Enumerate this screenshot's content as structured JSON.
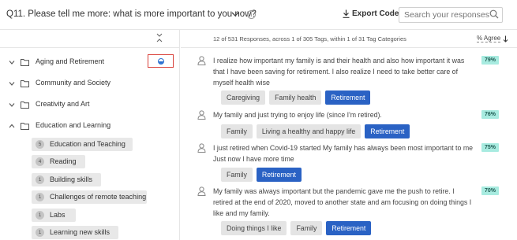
{
  "header": {
    "question": "Q11. Please tell me more: what is more important to you now?",
    "export_label": "Export Codes",
    "search_placeholder": "Search your responses"
  },
  "summary": {
    "text": "12 of 531 Responses, across 1 of 305 Tags, within 1 of 31 Tag Categories",
    "agree_label": "% Agree"
  },
  "categories": [
    {
      "label": "Aging and Retirement",
      "expanded": false,
      "progress": 0.5
    },
    {
      "label": "Community and Society",
      "expanded": false
    },
    {
      "label": "Creativity and Art",
      "expanded": false
    },
    {
      "label": "Education and Learning",
      "expanded": true
    }
  ],
  "tags": [
    {
      "count": "5",
      "label": "Education and Teaching"
    },
    {
      "count": "4",
      "label": "Reading"
    },
    {
      "count": "1",
      "label": "Building skills"
    },
    {
      "count": "1",
      "label": "Challenges of remote teaching"
    },
    {
      "count": "1",
      "label": "Labs"
    },
    {
      "count": "1",
      "label": "Learning new skills"
    }
  ],
  "responses": [
    {
      "text": "I realize how important my family is and their health and also how important it was that I have been saving for retirement. I also realize I need to take better care of myself health wise",
      "agree": "79%",
      "tags": [
        "Caregiving",
        "Family health",
        "Retirement"
      ],
      "active_tag": "Retirement"
    },
    {
      "text": "My family and just trying to enjoy life (since I'm retired).",
      "agree": "76%",
      "tags": [
        "Family",
        "Living a healthy and happy life",
        "Retirement"
      ],
      "active_tag": "Retirement"
    },
    {
      "text": "I just retired when Covid-19 started My family has always been most important to me Just now I have more time",
      "agree": "75%",
      "tags": [
        "Family",
        "Retirement"
      ],
      "active_tag": "Retirement"
    },
    {
      "text": "My family was always important but the pandemic gave me the push to retire. I retired at the end of 2020, moved to another state and am focusing on doing things I like and my family.",
      "agree": "70%",
      "tags": [
        "Doing things I like",
        "Family",
        "Retirement"
      ],
      "active_tag": "Retirement"
    }
  ],
  "colors": {
    "accent": "#2a62c4",
    "agree_badge": "#a8ebe0",
    "highlight": "#d9413a"
  }
}
